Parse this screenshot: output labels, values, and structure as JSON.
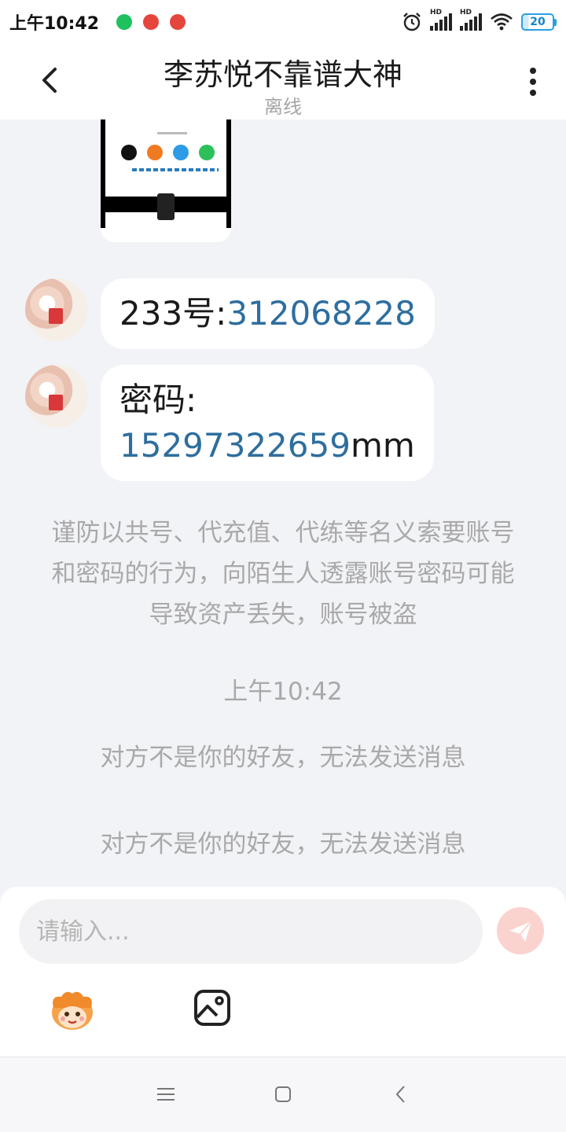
{
  "status_bar": {
    "time": "上午10:42",
    "hd_label": "HD",
    "battery_level": "20",
    "icons": [
      "wechat-notification-icon",
      "app-notification-icon",
      "app-notification-icon",
      "alarm-icon",
      "signal-icon",
      "signal-icon",
      "wifi-icon",
      "battery-icon"
    ]
  },
  "header": {
    "title": "李苏悦不靠谱大神",
    "status": "离线",
    "icons": [
      "back-arrow-icon",
      "more-vertical-icon"
    ]
  },
  "messages": [
    {
      "type": "image",
      "content": "shared-screenshot"
    },
    {
      "type": "text",
      "prefix": "233号:",
      "link": "312068228",
      "suffix": ""
    },
    {
      "type": "text",
      "line1": "密码:",
      "link": "15297322659",
      "suffix": "mm"
    }
  ],
  "system": {
    "warning": "谨防以共号、代充值、代练等名义索要账号和密码的行为，向陌生人透露账号密码可能导致资产丢失，账号被盗",
    "timestamp": "上午10:42",
    "notice_1": "对方不是你的好友，无法发送消息",
    "notice_2": "对方不是你的好友，无法发送消息"
  },
  "composer": {
    "placeholder": "请输入...",
    "icons": [
      "send-icon",
      "emoji-icon",
      "image-icon"
    ]
  },
  "colors": {
    "link": "#2e6e9e",
    "background": "#f2f3f7",
    "send_button": "#fbd3ce",
    "system_text": "#a9a9a9"
  }
}
